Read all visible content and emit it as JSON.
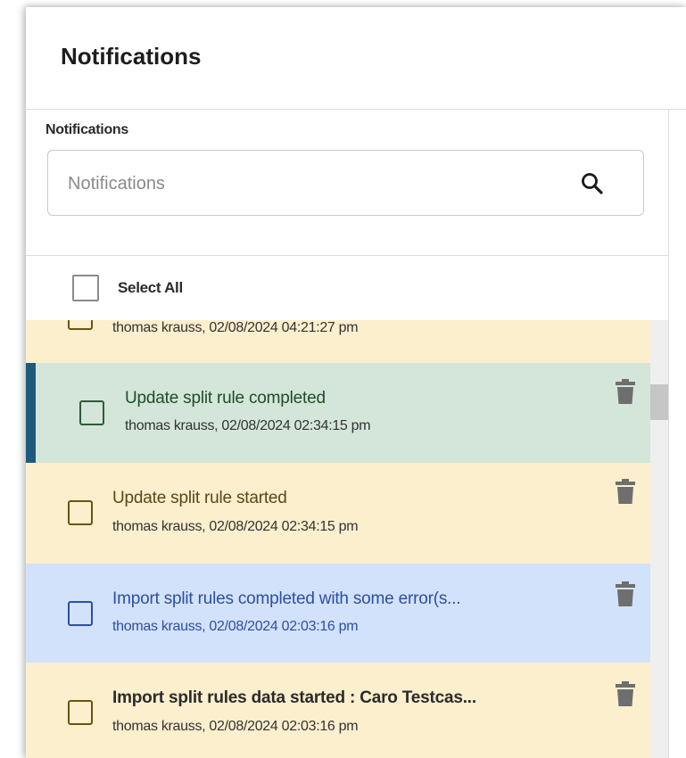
{
  "header": {
    "title": "Notifications"
  },
  "filter": {
    "label": "Notifications",
    "placeholder": "Notifications",
    "value": "",
    "icon": "search-icon"
  },
  "select_all": {
    "label": "Select All",
    "checked": false
  },
  "notifications": [
    {
      "title": "",
      "meta": "thomas krauss, 02/08/2024 04:21:27 pm",
      "status": "started",
      "bg": "#fcefcd",
      "checkbox_color": "#6b5412",
      "title_color": "#3a3a3a",
      "bold": false,
      "selected": false
    },
    {
      "title": "Update split rule completed",
      "meta": "thomas krauss, 02/08/2024 02:34:15 pm",
      "status": "completed",
      "bg": "#d4e6da",
      "checkbox_color": "#2f5a37",
      "title_color": "#1f4d27",
      "bold": false,
      "selected": true
    },
    {
      "title": "Update split rule started",
      "meta": "thomas krauss, 02/08/2024 02:34:15 pm",
      "status": "started",
      "bg": "#fcefcd",
      "checkbox_color": "#6b5412",
      "title_color": "#5a4716",
      "bold": false,
      "selected": false
    },
    {
      "title": "Import split rules completed with some error(s...",
      "meta": "thomas krauss, 02/08/2024 02:03:16 pm",
      "status": "warning",
      "bg": "#d3e2fb",
      "checkbox_color": "#2b4fa3",
      "title_color": "#2b4fa3",
      "meta_color": "#2b4fa3",
      "bold": false,
      "selected": false
    },
    {
      "title": "Import split rules data started : Caro Testcas...",
      "meta": "thomas krauss, 02/08/2024 02:03:16 pm",
      "status": "started",
      "bg": "#fcefcd",
      "checkbox_color": "#6b5412",
      "title_color": "#2b2b2b",
      "bold": true,
      "selected": false
    }
  ],
  "row_action_icon": "trash-icon"
}
